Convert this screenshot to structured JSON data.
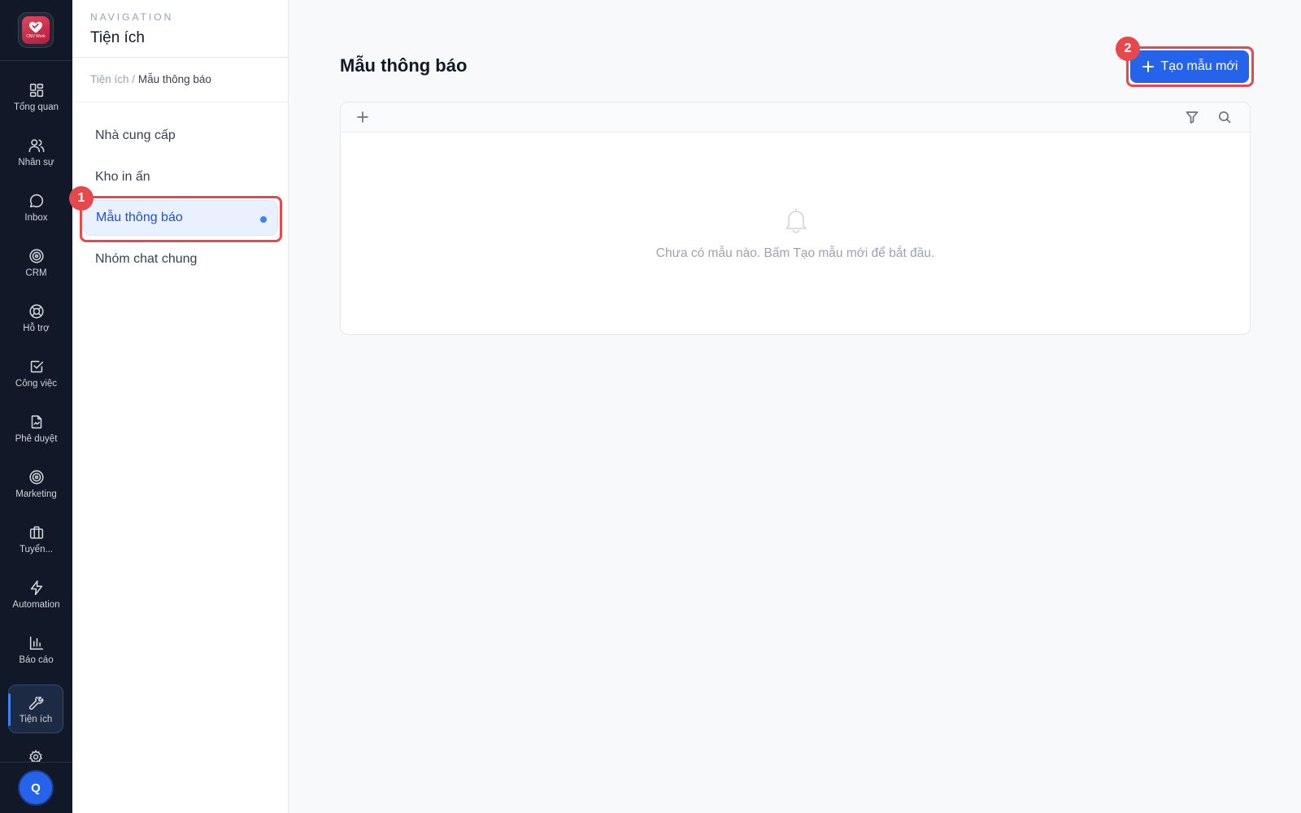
{
  "rail": {
    "items": [
      {
        "label": "Tổng quan",
        "icon": "dashboard-icon"
      },
      {
        "label": "Nhân sự",
        "icon": "users-icon"
      },
      {
        "label": "Inbox",
        "icon": "chat-bubble-icon"
      },
      {
        "label": "CRM",
        "icon": "target-icon"
      },
      {
        "label": "Hỗ trợ",
        "icon": "lifebuoy-icon"
      },
      {
        "label": "Công việc",
        "icon": "checkbox-icon"
      },
      {
        "label": "Phê duyệt",
        "icon": "file-signature-icon"
      },
      {
        "label": "Marketing",
        "icon": "target-icon"
      },
      {
        "label": "Tuyển...",
        "icon": "briefcase-icon"
      },
      {
        "label": "Automation",
        "icon": "lightning-icon"
      },
      {
        "label": "Báo cáo",
        "icon": "bar-chart-icon"
      },
      {
        "label": "Tiện ích",
        "icon": "wrench-icon"
      }
    ],
    "active_item": "Tiện ích",
    "logo_text": "CNV Work",
    "avatar_initial": "Q"
  },
  "nav": {
    "eyebrow": "NAVIGATION",
    "title": "Tiện ích",
    "breadcrumb": {
      "parent": "Tiện ích",
      "separator": "/",
      "current": "Mẫu thông báo"
    },
    "items": [
      {
        "label": "Nhà cung cấp"
      },
      {
        "label": "Kho in ấn"
      },
      {
        "label": "Mẫu thông báo"
      },
      {
        "label": "Nhóm chat chung"
      }
    ],
    "active_item": "Mẫu thông báo"
  },
  "main": {
    "title": "Mẫu thông báo",
    "create_button": "Tạo mẫu mới",
    "empty_message": "Chưa có mẫu nào. Bấm Tạo mẫu mới để bắt đầu."
  },
  "annotations": [
    {
      "number": "1"
    },
    {
      "number": "2"
    }
  ],
  "colors": {
    "accent": "#2563eb",
    "rail_bg": "#111827",
    "highlight": "#e5484d"
  }
}
